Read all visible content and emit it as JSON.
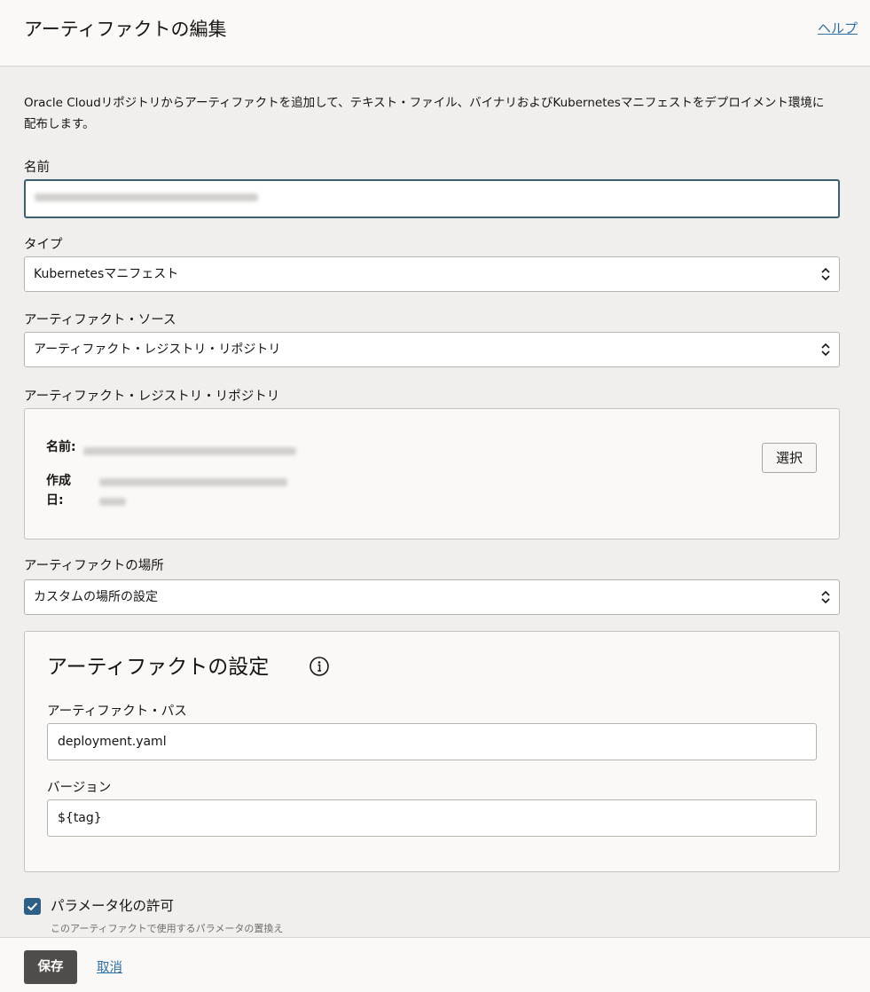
{
  "header": {
    "title": "アーティファクトの編集",
    "help_label": "ヘルプ"
  },
  "description": "Oracle Cloudリポジトリからアーティファクトを追加して、テキスト・ファイル、バイナリおよびKubernetesマニフェストをデプロイメント環境に配布します。",
  "name_field": {
    "label": "名前"
  },
  "type_field": {
    "label": "タイプ",
    "value": "Kubernetesマニフェスト"
  },
  "source_field": {
    "label": "アーティファクト・ソース",
    "value": "アーティファクト・レジストリ・リポジトリ"
  },
  "repository": {
    "label": "アーティファクト・レジストリ・リポジトリ",
    "name_key": "名前:",
    "created_key_line1": "作成",
    "created_key_line2": "日:",
    "select_label": "選択"
  },
  "location_field": {
    "label": "アーティファクトの場所",
    "value": "カスタムの場所の設定"
  },
  "settings": {
    "title": "アーティファクトの設定",
    "path_label": "アーティファクト・パス",
    "path_value": "deployment.yaml",
    "version_label": "バージョン",
    "version_value": "${tag}"
  },
  "parameterization": {
    "label": "パラメータ化の許可",
    "help": "このアーティファクトで使用するパラメータの置換え",
    "checked": true
  },
  "footer": {
    "save_label": "保存",
    "cancel_label": "取消"
  },
  "colors": {
    "accent": "#2e5f84",
    "link": "#2c6ea6",
    "primary_button": "#4f4c4a"
  }
}
